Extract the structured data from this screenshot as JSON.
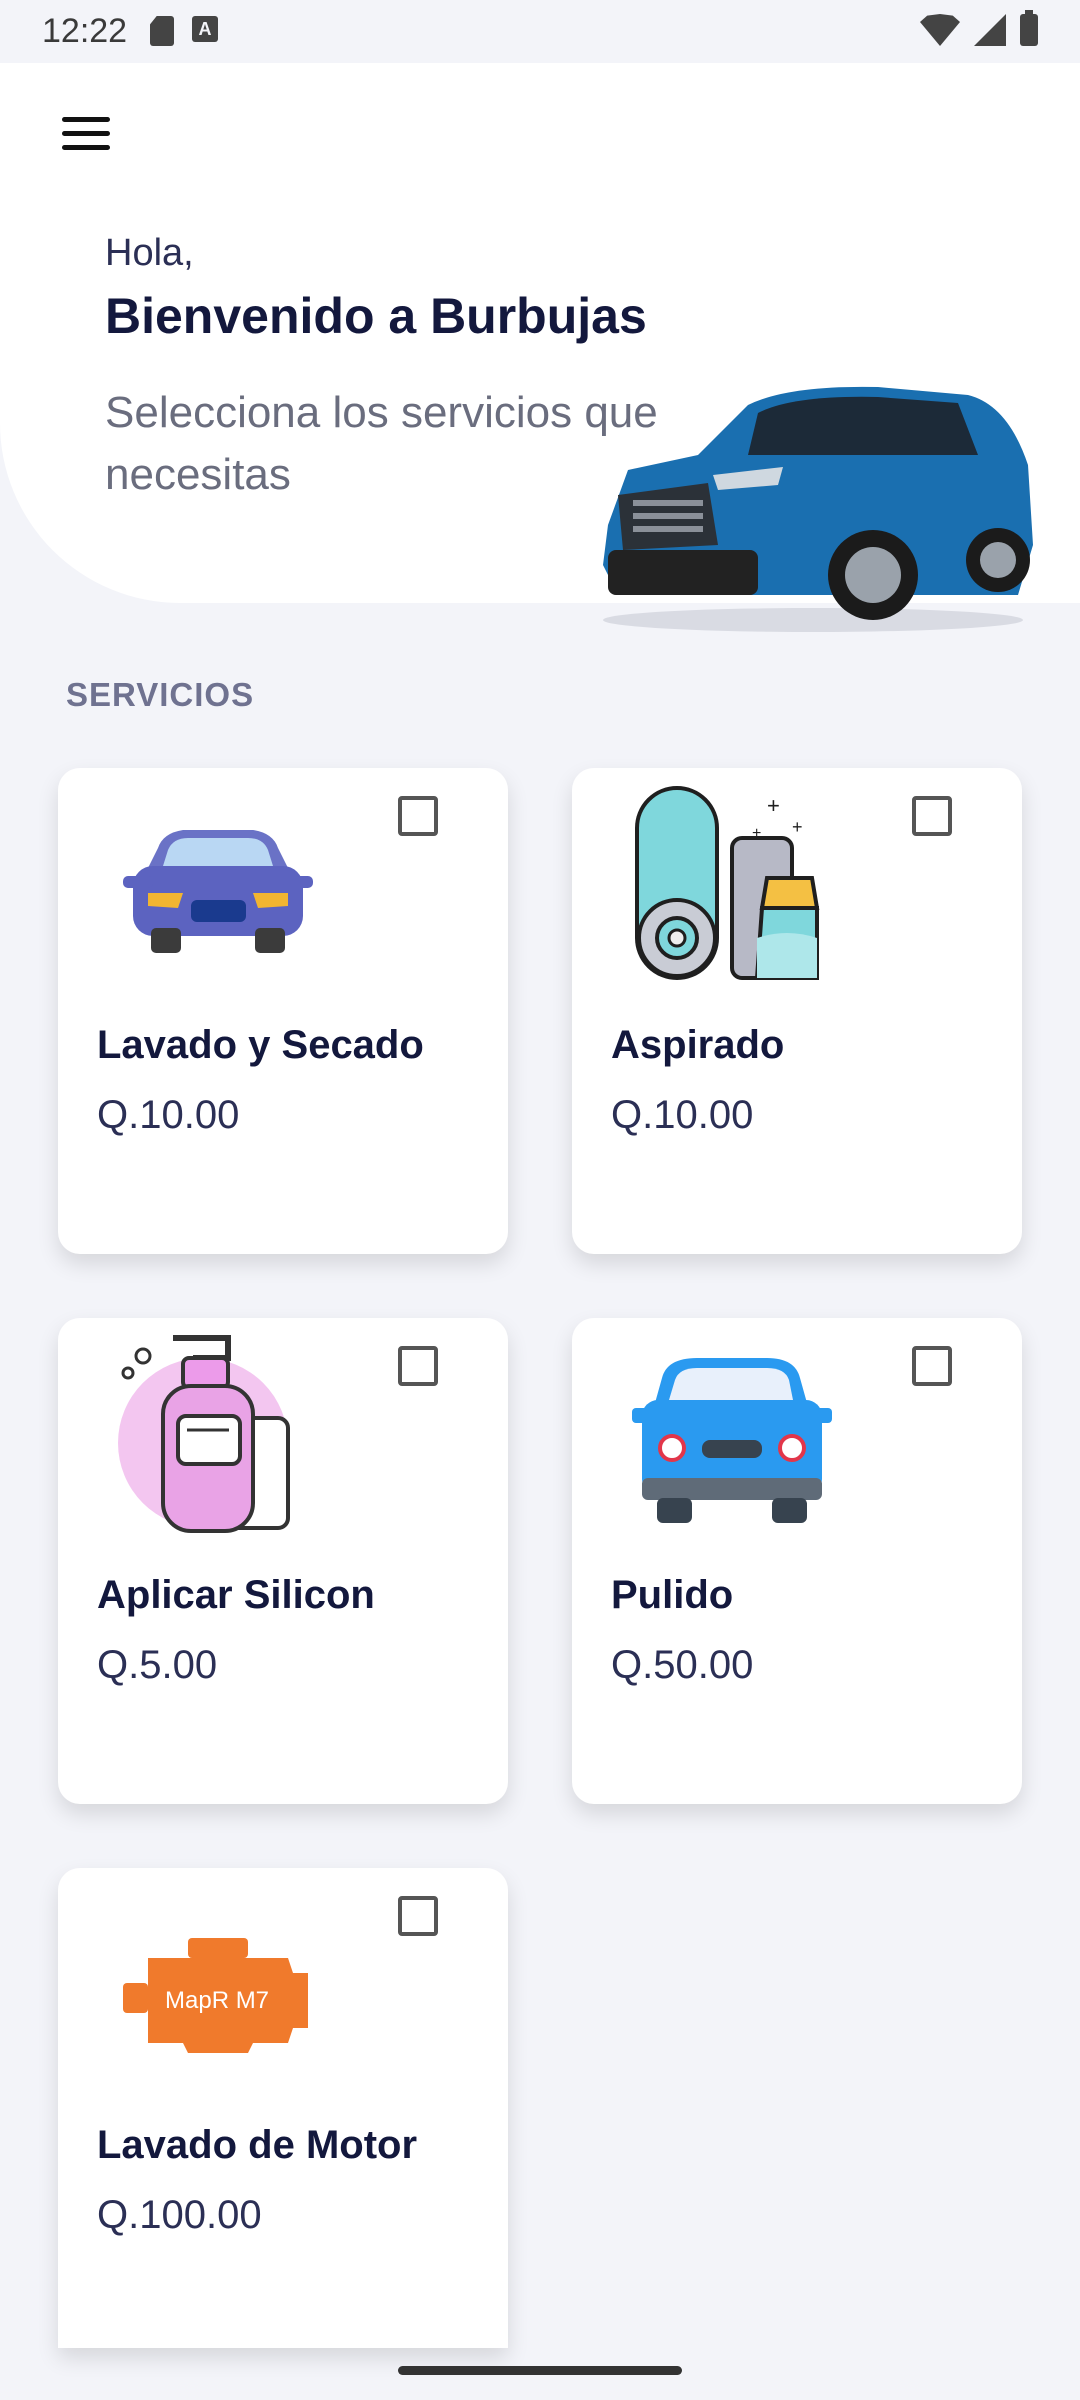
{
  "status": {
    "time": "12:22"
  },
  "header": {
    "greeting": "Hola,",
    "welcome": "Bienvenido a Burbujas",
    "subtitle": "Selecciona los servicios que necesitas"
  },
  "section_title": "SERVICIOS",
  "services": [
    {
      "name": "Lavado y Secado",
      "price": "Q.10.00",
      "icon": "car-front-icon",
      "checked": false
    },
    {
      "name": "Aspirado",
      "price": "Q.10.00",
      "icon": "vacuum-spray-icon",
      "checked": false
    },
    {
      "name": "Aplicar Silicon",
      "price": "Q.5.00",
      "icon": "soap-dispenser-icon",
      "checked": false
    },
    {
      "name": "Pulido",
      "price": "Q.50.00",
      "icon": "blue-car-icon",
      "checked": false
    },
    {
      "name": "Lavado de Motor",
      "price": "Q.100.00",
      "icon": "engine-icon",
      "checked": false
    }
  ],
  "engine_label": "MapR M7",
  "colors": {
    "accent": "#13183d",
    "background": "#f3f4f9"
  }
}
